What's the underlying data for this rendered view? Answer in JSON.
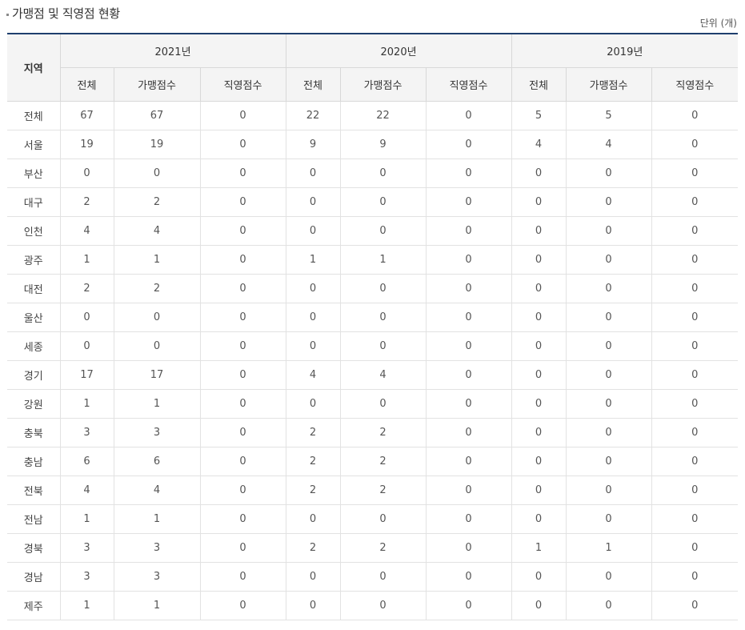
{
  "title": "가맹점 및 직영점 현황",
  "unit": "단위 (개)",
  "header": {
    "region": "지역",
    "years": [
      "2021년",
      "2020년",
      "2019년"
    ],
    "subcols": [
      "전체",
      "가맹점수",
      "직영점수"
    ]
  },
  "rows": [
    {
      "region": "전체",
      "v": [
        "67",
        "67",
        "0",
        "22",
        "22",
        "0",
        "5",
        "5",
        "0"
      ]
    },
    {
      "region": "서울",
      "v": [
        "19",
        "19",
        "0",
        "9",
        "9",
        "0",
        "4",
        "4",
        "0"
      ]
    },
    {
      "region": "부산",
      "v": [
        "0",
        "0",
        "0",
        "0",
        "0",
        "0",
        "0",
        "0",
        "0"
      ]
    },
    {
      "region": "대구",
      "v": [
        "2",
        "2",
        "0",
        "0",
        "0",
        "0",
        "0",
        "0",
        "0"
      ]
    },
    {
      "region": "인천",
      "v": [
        "4",
        "4",
        "0",
        "0",
        "0",
        "0",
        "0",
        "0",
        "0"
      ]
    },
    {
      "region": "광주",
      "v": [
        "1",
        "1",
        "0",
        "1",
        "1",
        "0",
        "0",
        "0",
        "0"
      ]
    },
    {
      "region": "대전",
      "v": [
        "2",
        "2",
        "0",
        "0",
        "0",
        "0",
        "0",
        "0",
        "0"
      ]
    },
    {
      "region": "울산",
      "v": [
        "0",
        "0",
        "0",
        "0",
        "0",
        "0",
        "0",
        "0",
        "0"
      ]
    },
    {
      "region": "세종",
      "v": [
        "0",
        "0",
        "0",
        "0",
        "0",
        "0",
        "0",
        "0",
        "0"
      ]
    },
    {
      "region": "경기",
      "v": [
        "17",
        "17",
        "0",
        "4",
        "4",
        "0",
        "0",
        "0",
        "0"
      ]
    },
    {
      "region": "강원",
      "v": [
        "1",
        "1",
        "0",
        "0",
        "0",
        "0",
        "0",
        "0",
        "0"
      ]
    },
    {
      "region": "충북",
      "v": [
        "3",
        "3",
        "0",
        "2",
        "2",
        "0",
        "0",
        "0",
        "0"
      ]
    },
    {
      "region": "충남",
      "v": [
        "6",
        "6",
        "0",
        "2",
        "2",
        "0",
        "0",
        "0",
        "0"
      ]
    },
    {
      "region": "전북",
      "v": [
        "4",
        "4",
        "0",
        "2",
        "2",
        "0",
        "0",
        "0",
        "0"
      ]
    },
    {
      "region": "전남",
      "v": [
        "1",
        "1",
        "0",
        "0",
        "0",
        "0",
        "0",
        "0",
        "0"
      ]
    },
    {
      "region": "경북",
      "v": [
        "3",
        "3",
        "0",
        "2",
        "2",
        "0",
        "1",
        "1",
        "0"
      ]
    },
    {
      "region": "경남",
      "v": [
        "3",
        "3",
        "0",
        "0",
        "0",
        "0",
        "0",
        "0",
        "0"
      ]
    },
    {
      "region": "제주",
      "v": [
        "1",
        "1",
        "0",
        "0",
        "0",
        "0",
        "0",
        "0",
        "0"
      ]
    }
  ]
}
